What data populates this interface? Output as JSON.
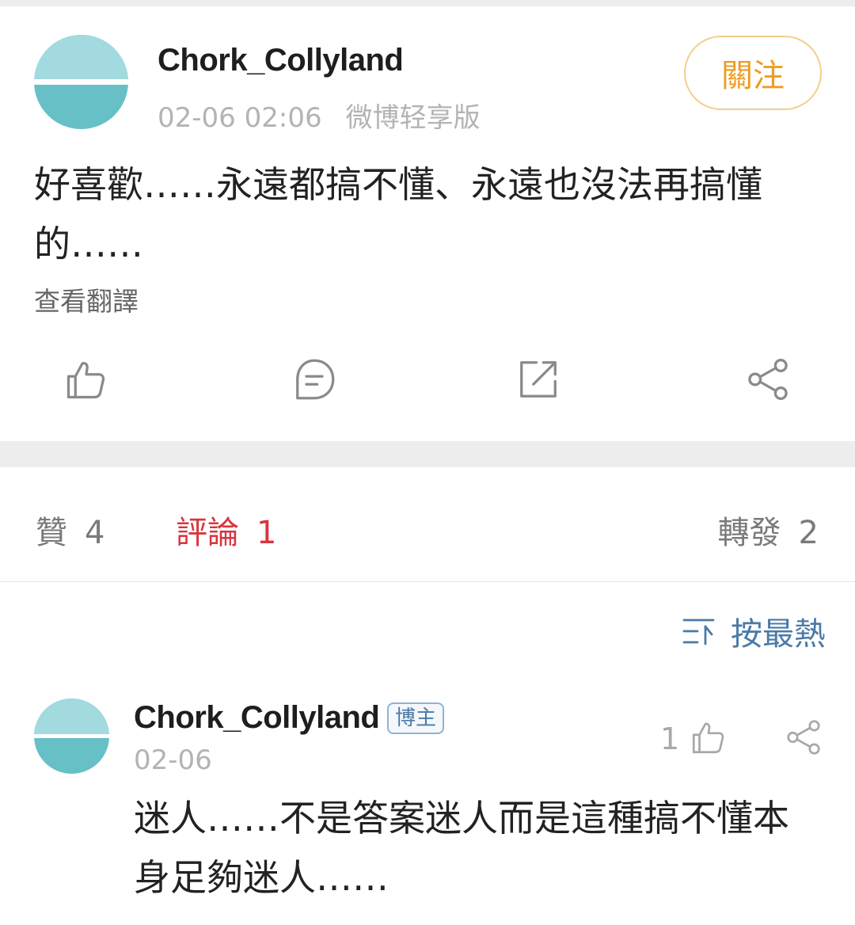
{
  "post": {
    "username": "Chork_Collyland",
    "time": "02-06 02:06",
    "source": "微博轻享版",
    "follow_label": "關注",
    "text": "好喜歡……永遠都搞不懂、永遠也沒法再搞懂的……",
    "translate_label": "查看翻譯"
  },
  "actions": {
    "icons": [
      "thumbs-up-icon",
      "comment-icon",
      "repost-icon",
      "share-icon"
    ]
  },
  "tabs": {
    "likes": {
      "label": "贊",
      "count": "4"
    },
    "comments": {
      "label": "評論",
      "count": "1"
    },
    "reposts": {
      "label": "轉發",
      "count": "2"
    }
  },
  "sort": {
    "label": "按最熱",
    "icon": "sort-icon"
  },
  "comment": {
    "username": "Chork_Collyland",
    "badge": "博主",
    "date": "02-06",
    "like_count": "1",
    "text": "迷人……不是答案迷人而是這種搞不懂本身足夠迷人……"
  },
  "colors": {
    "accent_red": "#d8353e",
    "follow_orange": "#ee9d22",
    "link_blue": "#4a7aa6",
    "avatar_teal": "#66c0c6"
  }
}
